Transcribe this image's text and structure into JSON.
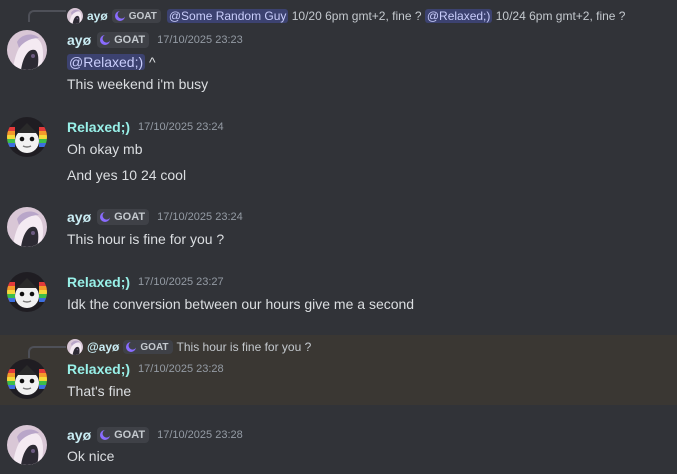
{
  "messages": [
    {
      "id": "m1",
      "reply": {
        "author": "ayø",
        "tag": "GOAT",
        "mention1": "@Some Random Guy",
        "text1": "10/20 6pm gmt+2, fine ?",
        "mention2": "@Relaxed;)",
        "text2": "10/24 6pm gmt+2, fine ?"
      },
      "author": "ayø",
      "tag": "GOAT",
      "time": "17/10/2025 23:23",
      "lines": [
        {
          "mention": "@Relaxed;)",
          "text": "^"
        },
        {
          "text": "This weekend i'm busy"
        }
      ]
    },
    {
      "id": "m2",
      "author": "Relaxed;)",
      "time": "17/10/2025 23:24",
      "lines": [
        {
          "text": "Oh okay mb"
        },
        {
          "text": "And yes 10 24 cool"
        }
      ]
    },
    {
      "id": "m3",
      "author": "ayø",
      "tag": "GOAT",
      "time": "17/10/2025 23:24",
      "lines": [
        {
          "text": "This hour is fine for you ?"
        }
      ]
    },
    {
      "id": "m4",
      "author": "Relaxed;)",
      "time": "17/10/2025 23:27",
      "lines": [
        {
          "text": "Idk the conversion between our hours give me a second"
        }
      ]
    },
    {
      "id": "m5",
      "reply": {
        "author": "@ayø",
        "tag": "GOAT",
        "text1": "This hour is fine for you ?"
      },
      "author": "Relaxed;)",
      "time": "17/10/2025 23:28",
      "lines": [
        {
          "text": "That's fine"
        }
      ]
    },
    {
      "id": "m6",
      "author": "ayø",
      "tag": "GOAT",
      "time": "17/10/2025 23:28",
      "lines": [
        {
          "text": "Ok nice"
        }
      ]
    }
  ],
  "colors": {
    "background": "#313338",
    "highlight": "#3a3733",
    "mention_bg": "#3c4270",
    "username_ayo": "#c9ecf3",
    "username_relaxed": "#98f0e8"
  },
  "icons": {
    "tag_icon": "moon-icon",
    "avatar_ayo": "avatar-ayo",
    "avatar_relaxed": "avatar-relaxed"
  }
}
